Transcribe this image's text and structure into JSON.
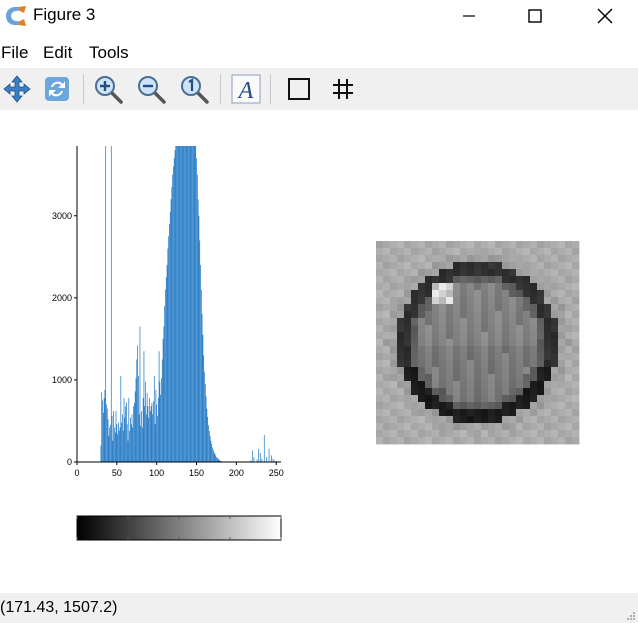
{
  "window": {
    "title": "Figure 3"
  },
  "menu": [
    "File",
    "Edit",
    "Tools"
  ],
  "toolbar": {
    "buttons": [
      "pan",
      "rotate",
      "zoom-in",
      "zoom-out",
      "zoom-reset",
      "insert-text",
      "rectangle",
      "grid"
    ]
  },
  "status": {
    "text": "(171.43, 1507.2)"
  },
  "colors": {
    "bar": "#1f77c4",
    "toolbar_bg": "#f0f0f0"
  },
  "chart_data": {
    "type": "bar",
    "x": [
      30,
      31,
      32,
      33,
      34,
      35,
      36,
      37,
      38,
      39,
      40,
      41,
      42,
      43,
      44,
      45,
      46,
      47,
      48,
      49,
      50,
      51,
      52,
      53,
      54,
      55,
      56,
      57,
      58,
      59,
      60,
      61,
      62,
      63,
      64,
      65,
      66,
      67,
      68,
      69,
      70,
      71,
      72,
      73,
      74,
      75,
      76,
      77,
      78,
      79,
      80,
      81,
      82,
      83,
      84,
      85,
      86,
      87,
      88,
      89,
      90,
      91,
      92,
      93,
      94,
      95,
      96,
      97,
      98,
      99,
      100,
      101,
      102,
      103,
      104,
      105,
      106,
      107,
      108,
      109,
      110,
      111,
      112,
      113,
      114,
      115,
      116,
      117,
      118,
      119,
      120,
      121,
      122,
      123,
      124,
      125,
      126,
      127,
      128,
      129,
      130,
      131,
      132,
      133,
      134,
      135,
      136,
      137,
      138,
      139,
      140,
      141,
      142,
      143,
      144,
      145,
      146,
      147,
      148,
      149,
      150,
      151,
      152,
      153,
      154,
      155,
      156,
      157,
      158,
      159,
      160,
      161,
      162,
      163,
      164,
      165,
      166,
      167,
      168,
      169,
      170,
      171,
      172,
      173,
      174,
      175,
      176,
      177,
      178,
      179,
      180,
      181,
      182,
      183,
      184,
      185,
      186,
      187,
      188,
      189,
      190,
      195,
      200,
      203,
      206,
      210,
      212,
      215,
      218,
      220,
      222,
      226,
      228,
      230,
      232,
      235,
      238,
      241,
      244,
      246,
      248,
      250,
      252,
      254,
      256
    ],
    "values": [
      200,
      850,
      750,
      600,
      780,
      880,
      3850,
      700,
      650,
      520,
      320,
      420,
      450,
      3850,
      560,
      260,
      620,
      420,
      360,
      620,
      460,
      340,
      480,
      380,
      420,
      1050,
      480,
      580,
      380,
      780,
      540,
      680,
      720,
      460,
      260,
      780,
      380,
      540,
      460,
      580,
      420,
      680,
      720,
      860,
      1020,
      1250,
      1420,
      1050,
      580,
      1650,
      440,
      620,
      420,
      780,
      1350,
      680,
      980,
      580,
      840,
      680,
      540,
      780,
      620,
      680,
      720,
      580,
      740,
      1050,
      460,
      880,
      700,
      560,
      780,
      1350,
      980,
      820,
      1020,
      1250,
      1500,
      1650,
      1900,
      2100,
      2250,
      2400,
      2600,
      2750,
      2900,
      3050,
      3200,
      3350,
      3500,
      3600,
      3700,
      3800,
      3850,
      3850,
      3850,
      3850,
      3850,
      3850,
      3850,
      3850,
      3850,
      3850,
      3850,
      3850,
      3850,
      3850,
      3850,
      3850,
      3850,
      3850,
      3850,
      3850,
      3850,
      3850,
      3850,
      3850,
      3850,
      3850,
      3700,
      3500,
      3200,
      3000,
      2700,
      2400,
      2100,
      1800,
      1550,
      1300,
      1100,
      950,
      800,
      650,
      550,
      450,
      380,
      320,
      260,
      220,
      180,
      150,
      120,
      100,
      80,
      60,
      50,
      40,
      30,
      20,
      15,
      10,
      8,
      6,
      5,
      4,
      3,
      2,
      2,
      1,
      1,
      1,
      1,
      1,
      1,
      1,
      0,
      0,
      20,
      140,
      60,
      30,
      160,
      110,
      40,
      330,
      60,
      160,
      80,
      40,
      20,
      10,
      5,
      3,
      2,
      1
    ],
    "xlim": [
      0,
      256
    ],
    "ylim": [
      0,
      3850
    ],
    "xticks": [
      "0",
      "50",
      "100",
      "150",
      "200",
      "250"
    ],
    "yticks": [
      "0",
      "1000",
      "2000",
      "3000"
    ],
    "xtick_values": [
      0,
      50,
      100,
      150,
      200,
      250
    ],
    "ytick_values": [
      0,
      1000,
      2000,
      3000
    ],
    "colorbar_ticks": [
      0,
      25,
      50,
      75,
      100
    ]
  }
}
